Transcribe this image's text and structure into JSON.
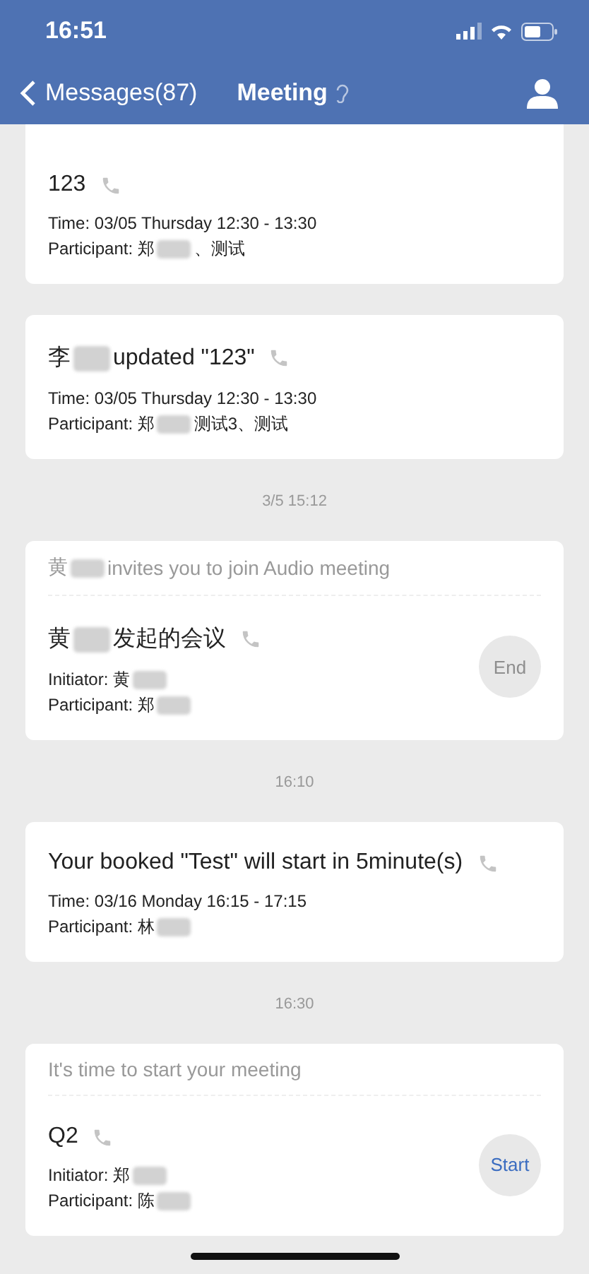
{
  "status_bar": {
    "time": "16:51"
  },
  "nav": {
    "back": "Messages(87)",
    "title": "Meeting"
  },
  "feed": [
    {
      "kind": "card",
      "clipped": true,
      "title": [
        {
          "kind": "text",
          "text": "123"
        }
      ],
      "lines": [
        [
          {
            "kind": "text",
            "text": "Time: 03/05 Thursday 12:30 - 13:30"
          }
        ],
        [
          {
            "kind": "text",
            "text": "Participant: 郑"
          },
          {
            "kind": "blur"
          },
          {
            "kind": "text",
            "text": "、测试"
          }
        ]
      ]
    },
    {
      "kind": "card",
      "clipped": false,
      "title": [
        {
          "kind": "text",
          "text": "李"
        },
        {
          "kind": "blur"
        },
        {
          "kind": "text",
          "text": "updated \"123\""
        }
      ],
      "lines": [
        [
          {
            "kind": "text",
            "text": "Time: 03/05 Thursday 12:30 - 13:30"
          }
        ],
        [
          {
            "kind": "text",
            "text": "Participant: 郑"
          },
          {
            "kind": "blur"
          },
          {
            "kind": "text",
            "text": "测试3、测试"
          }
        ]
      ]
    },
    {
      "kind": "time",
      "text": "3/5 15:12"
    },
    {
      "kind": "card",
      "clipped": false,
      "header": [
        {
          "kind": "text",
          "text": "黄"
        },
        {
          "kind": "blur"
        },
        {
          "kind": "text",
          "text": "invites you to join Audio meeting"
        }
      ],
      "title": [
        {
          "kind": "text",
          "text": "黄"
        },
        {
          "kind": "blur"
        },
        {
          "kind": "text",
          "text": "发起的会议"
        }
      ],
      "lines": [
        [
          {
            "kind": "text",
            "text": "Initiator: 黄"
          },
          {
            "kind": "blur"
          }
        ],
        [
          {
            "kind": "text",
            "text": "Participant: 郑"
          },
          {
            "kind": "blur"
          }
        ]
      ],
      "button": {
        "label": "End",
        "disabled": true
      }
    },
    {
      "kind": "time",
      "text": "16:10"
    },
    {
      "kind": "card",
      "clipped": false,
      "title": [
        {
          "kind": "text",
          "text": "Your booked \"Test\" will start in 5minute(s)"
        }
      ],
      "lines": [
        [
          {
            "kind": "text",
            "text": "Time: 03/16 Monday 16:15 - 17:15"
          }
        ],
        [
          {
            "kind": "text",
            "text": "Participant: 林"
          },
          {
            "kind": "blur"
          }
        ]
      ]
    },
    {
      "kind": "time",
      "text": "16:30"
    },
    {
      "kind": "card",
      "clipped": false,
      "header": [
        {
          "kind": "text",
          "text": "It's time to start your meeting"
        }
      ],
      "title": [
        {
          "kind": "text",
          "text": "Q2"
        }
      ],
      "lines": [
        [
          {
            "kind": "text",
            "text": "Initiator: 郑"
          },
          {
            "kind": "blur"
          }
        ],
        [
          {
            "kind": "text",
            "text": "Participant: 陈"
          },
          {
            "kind": "blur"
          }
        ]
      ],
      "button": {
        "label": "Start",
        "disabled": false
      }
    }
  ]
}
